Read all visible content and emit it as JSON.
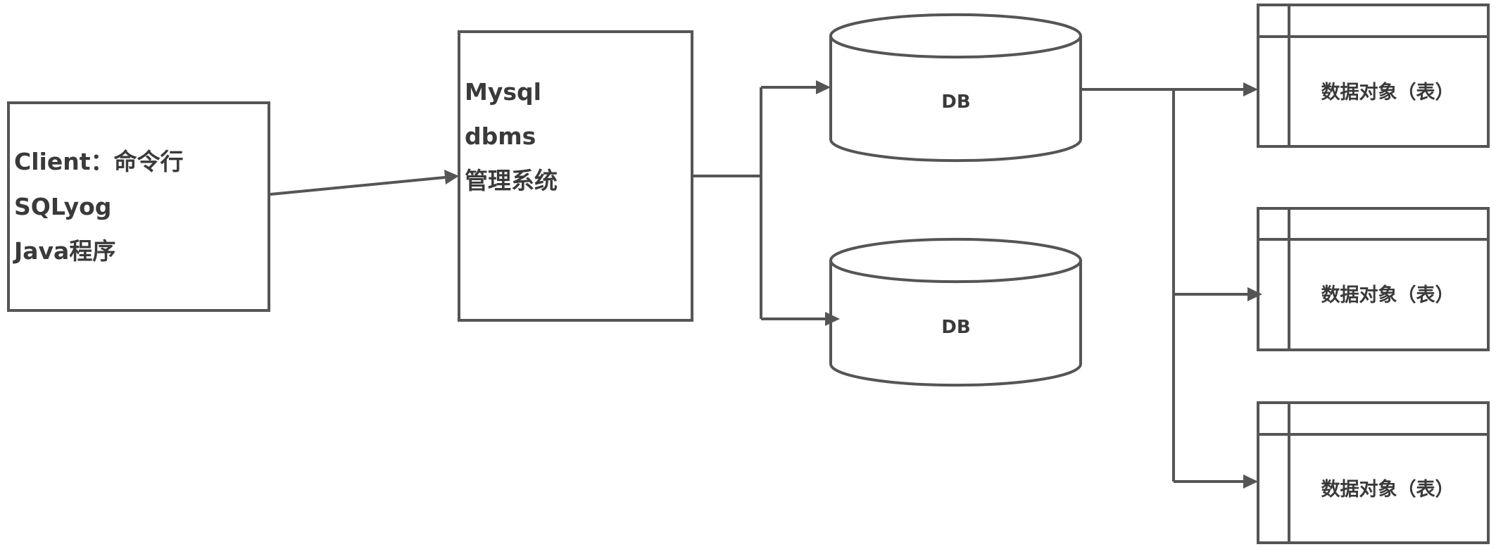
{
  "client": {
    "lines": [
      "Client：命令行",
      "SQLyog",
      "Java程序"
    ]
  },
  "dbms": {
    "lines": [
      "Mysql",
      "dbms",
      "管理系统"
    ]
  },
  "databases": [
    {
      "label": "DB"
    },
    {
      "label": "DB"
    }
  ],
  "tables": [
    {
      "label": "数据对象（表）"
    },
    {
      "label": "数据对象（表）"
    },
    {
      "label": "数据对象（表）"
    }
  ]
}
